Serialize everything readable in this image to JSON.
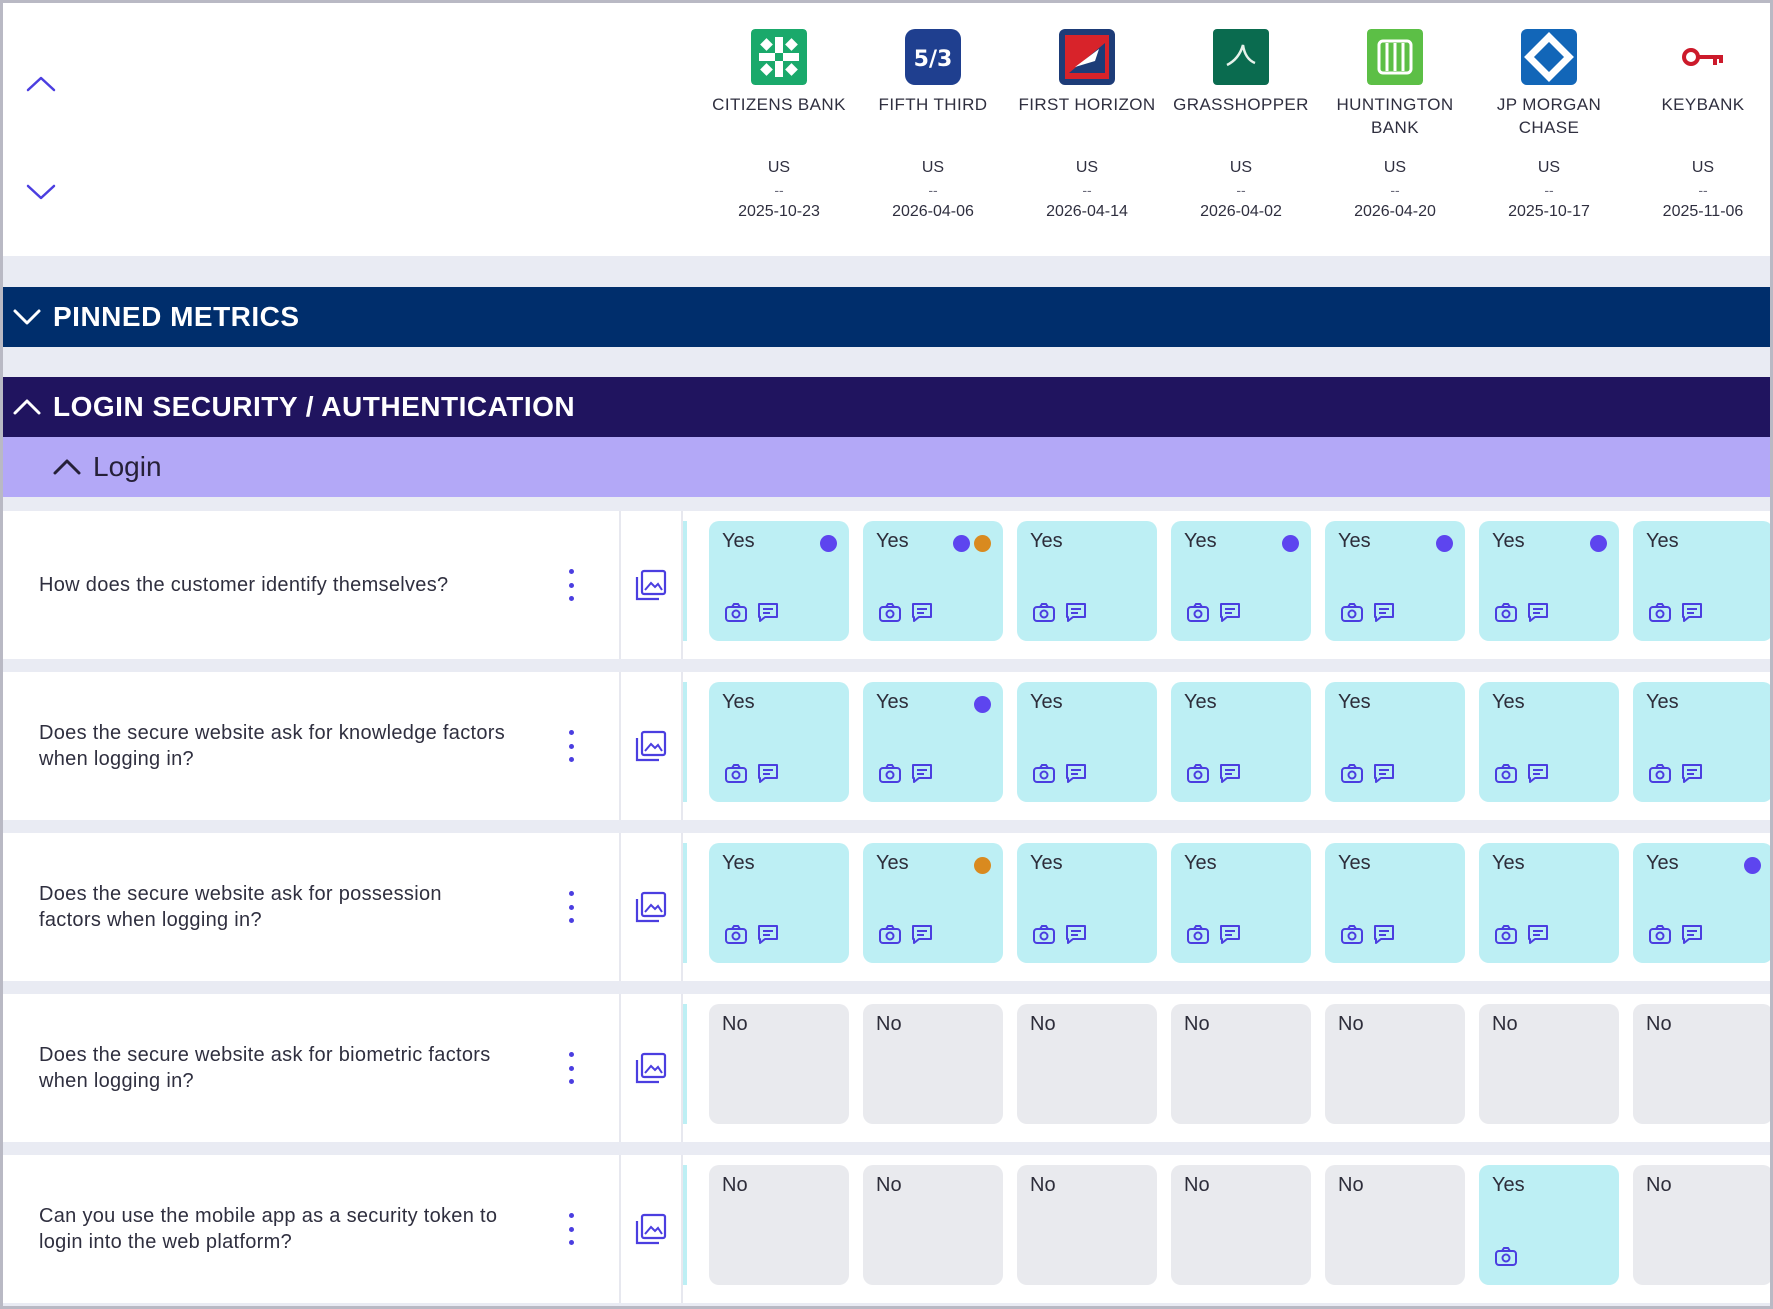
{
  "colors": {
    "pinned_bar": "#002e6c",
    "section_bar": "#20145f",
    "subsection_bar": "#b3a8f7",
    "yes_cell": "#bdeff4",
    "no_cell": "#e9eaee",
    "dot_purple": "#5d45ef",
    "dot_orange": "#d98a1f",
    "accent": "#4b3ee0"
  },
  "header": {
    "scroll_up_icon": "chevron-up-icon",
    "scroll_down_icon": "chevron-down-icon",
    "banks": [
      {
        "id": "citizens",
        "name": "CITIZENS BANK",
        "country": "US",
        "sep": "--",
        "date": "2025-10-23",
        "logo_color": "#1aa96b",
        "logo_icon": "citizens-logo-icon"
      },
      {
        "id": "fifth-third",
        "name": "FIFTH THIRD",
        "country": "US",
        "sep": "--",
        "date": "2026-04-06",
        "logo_color": "#1f3f8f",
        "logo_icon": "fifth-third-logo-icon"
      },
      {
        "id": "first-horizon",
        "name": "FIRST HORIZON",
        "country": "US",
        "sep": "--",
        "date": "2026-04-14",
        "logo_color": "#d8232a",
        "logo_icon": "first-horizon-logo-icon"
      },
      {
        "id": "grasshopper",
        "name": "GRASSHOPPER",
        "country": "US",
        "sep": "--",
        "date": "2026-04-02",
        "logo_color": "#0a6b4f",
        "logo_icon": "grasshopper-logo-icon"
      },
      {
        "id": "huntington",
        "name": "HUNTINGTON BANK",
        "country": "US",
        "sep": "--",
        "date": "2026-04-20",
        "logo_color": "#5cbf46",
        "logo_icon": "huntington-logo-icon"
      },
      {
        "id": "jpmorgan",
        "name": "JP MORGAN CHASE",
        "country": "US",
        "sep": "--",
        "date": "2025-10-17",
        "logo_color": "#1266b8",
        "logo_icon": "chase-logo-icon"
      },
      {
        "id": "keybank",
        "name": "KEYBANK",
        "country": "US",
        "sep": "--",
        "date": "2025-11-06",
        "logo_color": "#cc1a2b",
        "logo_icon": "key-logo-icon"
      }
    ]
  },
  "sections": {
    "pinned": {
      "title": "PINNED METRICS",
      "icon": "chevron-down-icon"
    },
    "login_security": {
      "title": "LOGIN SECURITY / AUTHENTICATION",
      "icon": "chevron-up-icon"
    },
    "login": {
      "title": "Login",
      "icon": "chevron-up-icon"
    }
  },
  "rows": [
    {
      "question": "How does the customer identify themselves?",
      "cells": [
        {
          "value": "Yes",
          "dots": [
            "purple"
          ],
          "icons": [
            "camera",
            "comment"
          ]
        },
        {
          "value": "Yes",
          "dots": [
            "purple",
            "orange"
          ],
          "icons": [
            "camera",
            "comment"
          ]
        },
        {
          "value": "Yes",
          "dots": [],
          "icons": [
            "camera",
            "comment"
          ]
        },
        {
          "value": "Yes",
          "dots": [
            "purple"
          ],
          "icons": [
            "camera",
            "comment"
          ]
        },
        {
          "value": "Yes",
          "dots": [
            "purple"
          ],
          "icons": [
            "camera",
            "comment"
          ]
        },
        {
          "value": "Yes",
          "dots": [
            "purple"
          ],
          "icons": [
            "camera",
            "comment"
          ]
        },
        {
          "value": "Yes",
          "dots": [],
          "icons": [
            "camera",
            "comment"
          ]
        }
      ]
    },
    {
      "question": "Does the secure website ask for knowledge factors when logging in?",
      "cells": [
        {
          "value": "Yes",
          "dots": [],
          "icons": [
            "camera",
            "comment"
          ]
        },
        {
          "value": "Yes",
          "dots": [
            "purple"
          ],
          "icons": [
            "camera",
            "comment"
          ]
        },
        {
          "value": "Yes",
          "dots": [],
          "icons": [
            "camera",
            "comment"
          ]
        },
        {
          "value": "Yes",
          "dots": [],
          "icons": [
            "camera",
            "comment"
          ]
        },
        {
          "value": "Yes",
          "dots": [],
          "icons": [
            "camera",
            "comment"
          ]
        },
        {
          "value": "Yes",
          "dots": [],
          "icons": [
            "camera",
            "comment"
          ]
        },
        {
          "value": "Yes",
          "dots": [],
          "icons": [
            "camera",
            "comment"
          ]
        }
      ]
    },
    {
      "question": "Does the secure website ask for possession factors when logging in?",
      "cells": [
        {
          "value": "Yes",
          "dots": [],
          "icons": [
            "camera",
            "comment"
          ]
        },
        {
          "value": "Yes",
          "dots": [
            "orange"
          ],
          "icons": [
            "camera",
            "comment"
          ]
        },
        {
          "value": "Yes",
          "dots": [],
          "icons": [
            "camera",
            "comment"
          ]
        },
        {
          "value": "Yes",
          "dots": [],
          "icons": [
            "camera",
            "comment"
          ]
        },
        {
          "value": "Yes",
          "dots": [],
          "icons": [
            "camera",
            "comment"
          ]
        },
        {
          "value": "Yes",
          "dots": [],
          "icons": [
            "camera",
            "comment"
          ]
        },
        {
          "value": "Yes",
          "dots": [
            "purple"
          ],
          "icons": [
            "camera",
            "comment"
          ]
        }
      ]
    },
    {
      "question": "Does the secure website ask for biometric factors when logging in?",
      "cells": [
        {
          "value": "No",
          "dots": [],
          "icons": []
        },
        {
          "value": "No",
          "dots": [],
          "icons": []
        },
        {
          "value": "No",
          "dots": [],
          "icons": []
        },
        {
          "value": "No",
          "dots": [],
          "icons": []
        },
        {
          "value": "No",
          "dots": [],
          "icons": []
        },
        {
          "value": "No",
          "dots": [],
          "icons": []
        },
        {
          "value": "No",
          "dots": [],
          "icons": []
        }
      ]
    },
    {
      "question": "Can you use the mobile app as a security token to login into the web platform?",
      "cells": [
        {
          "value": "No",
          "dots": [],
          "icons": []
        },
        {
          "value": "No",
          "dots": [],
          "icons": []
        },
        {
          "value": "No",
          "dots": [],
          "icons": []
        },
        {
          "value": "No",
          "dots": [],
          "icons": []
        },
        {
          "value": "No",
          "dots": [],
          "icons": []
        },
        {
          "value": "Yes",
          "dots": [],
          "icons": [
            "camera"
          ]
        },
        {
          "value": "No",
          "dots": [],
          "icons": []
        }
      ]
    }
  ]
}
